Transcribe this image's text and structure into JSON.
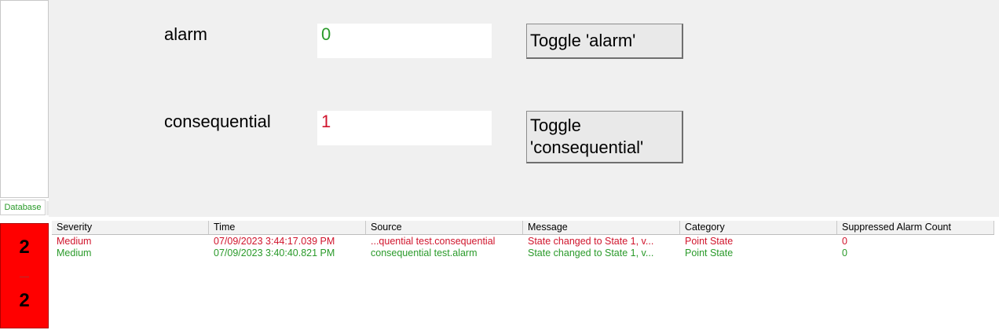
{
  "sidebar": {
    "tab_label": "Database"
  },
  "panel": {
    "rows": [
      {
        "label": "alarm",
        "value": "0",
        "value_color": "#2a9a2a",
        "button_label": "Toggle 'alarm'"
      },
      {
        "label": "consequential",
        "value": "1",
        "value_color": "#d0142c",
        "button_label": "Toggle 'consequential'"
      }
    ]
  },
  "alarm_counter": {
    "top": "2",
    "bottom": "2",
    "color": "#ff0000"
  },
  "alarm_table": {
    "columns": [
      "Severity",
      "Time",
      "Source",
      "Message",
      "Category",
      "Suppressed Alarm Count"
    ],
    "rows": [
      {
        "severity": "Medium",
        "time": "07/09/2023 3:44:17.039 PM",
        "source": "...quential test.consequential",
        "message": "State changed to State 1, v...",
        "category": "Point State",
        "suppressed": "0",
        "color": "#d0142c"
      },
      {
        "severity": "Medium",
        "time": "07/09/2023 3:40:40.821 PM",
        "source": "consequential test.alarm",
        "message": "State changed to State 1, v...",
        "category": "Point State",
        "suppressed": "0",
        "color": "#2a9a2a"
      }
    ]
  }
}
